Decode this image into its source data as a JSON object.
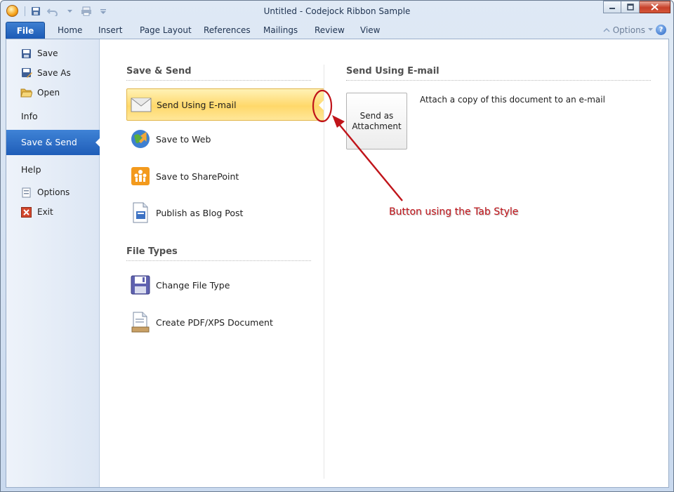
{
  "window": {
    "title": "Untitled - Codejock Ribbon Sample"
  },
  "ribbon": {
    "file_tab": "File",
    "tabs": [
      "Home",
      "Insert",
      "Page Layout",
      "References",
      "Mailings",
      "Review",
      "View"
    ],
    "options_label": "Options",
    "help_icon_text": "?"
  },
  "nav": {
    "save": "Save",
    "save_as": "Save As",
    "open": "Open",
    "info": "Info",
    "save_send": "Save & Send",
    "help": "Help",
    "options": "Options",
    "exit": "Exit"
  },
  "middle": {
    "section1_title": "Save & Send",
    "send_email": "Send Using E-mail",
    "save_web": "Save to Web",
    "save_sharepoint": "Save to SharePoint",
    "publish_blog": "Publish as Blog Post",
    "section2_title": "File Types",
    "change_type": "Change File Type",
    "create_pdf": "Create PDF/XPS Document"
  },
  "right": {
    "title": "Send Using E-mail",
    "button_line1": "Send as",
    "button_line2": "Attachment",
    "description": "Attach a copy of this document to an e-mail"
  },
  "annotation": {
    "text": "Button using the Tab Style",
    "color": "#c0141a"
  },
  "colors": {
    "file_tab": "#2a6bc4",
    "selected_nav": "#2a6bc4",
    "selected_item": "#ffd86a"
  }
}
